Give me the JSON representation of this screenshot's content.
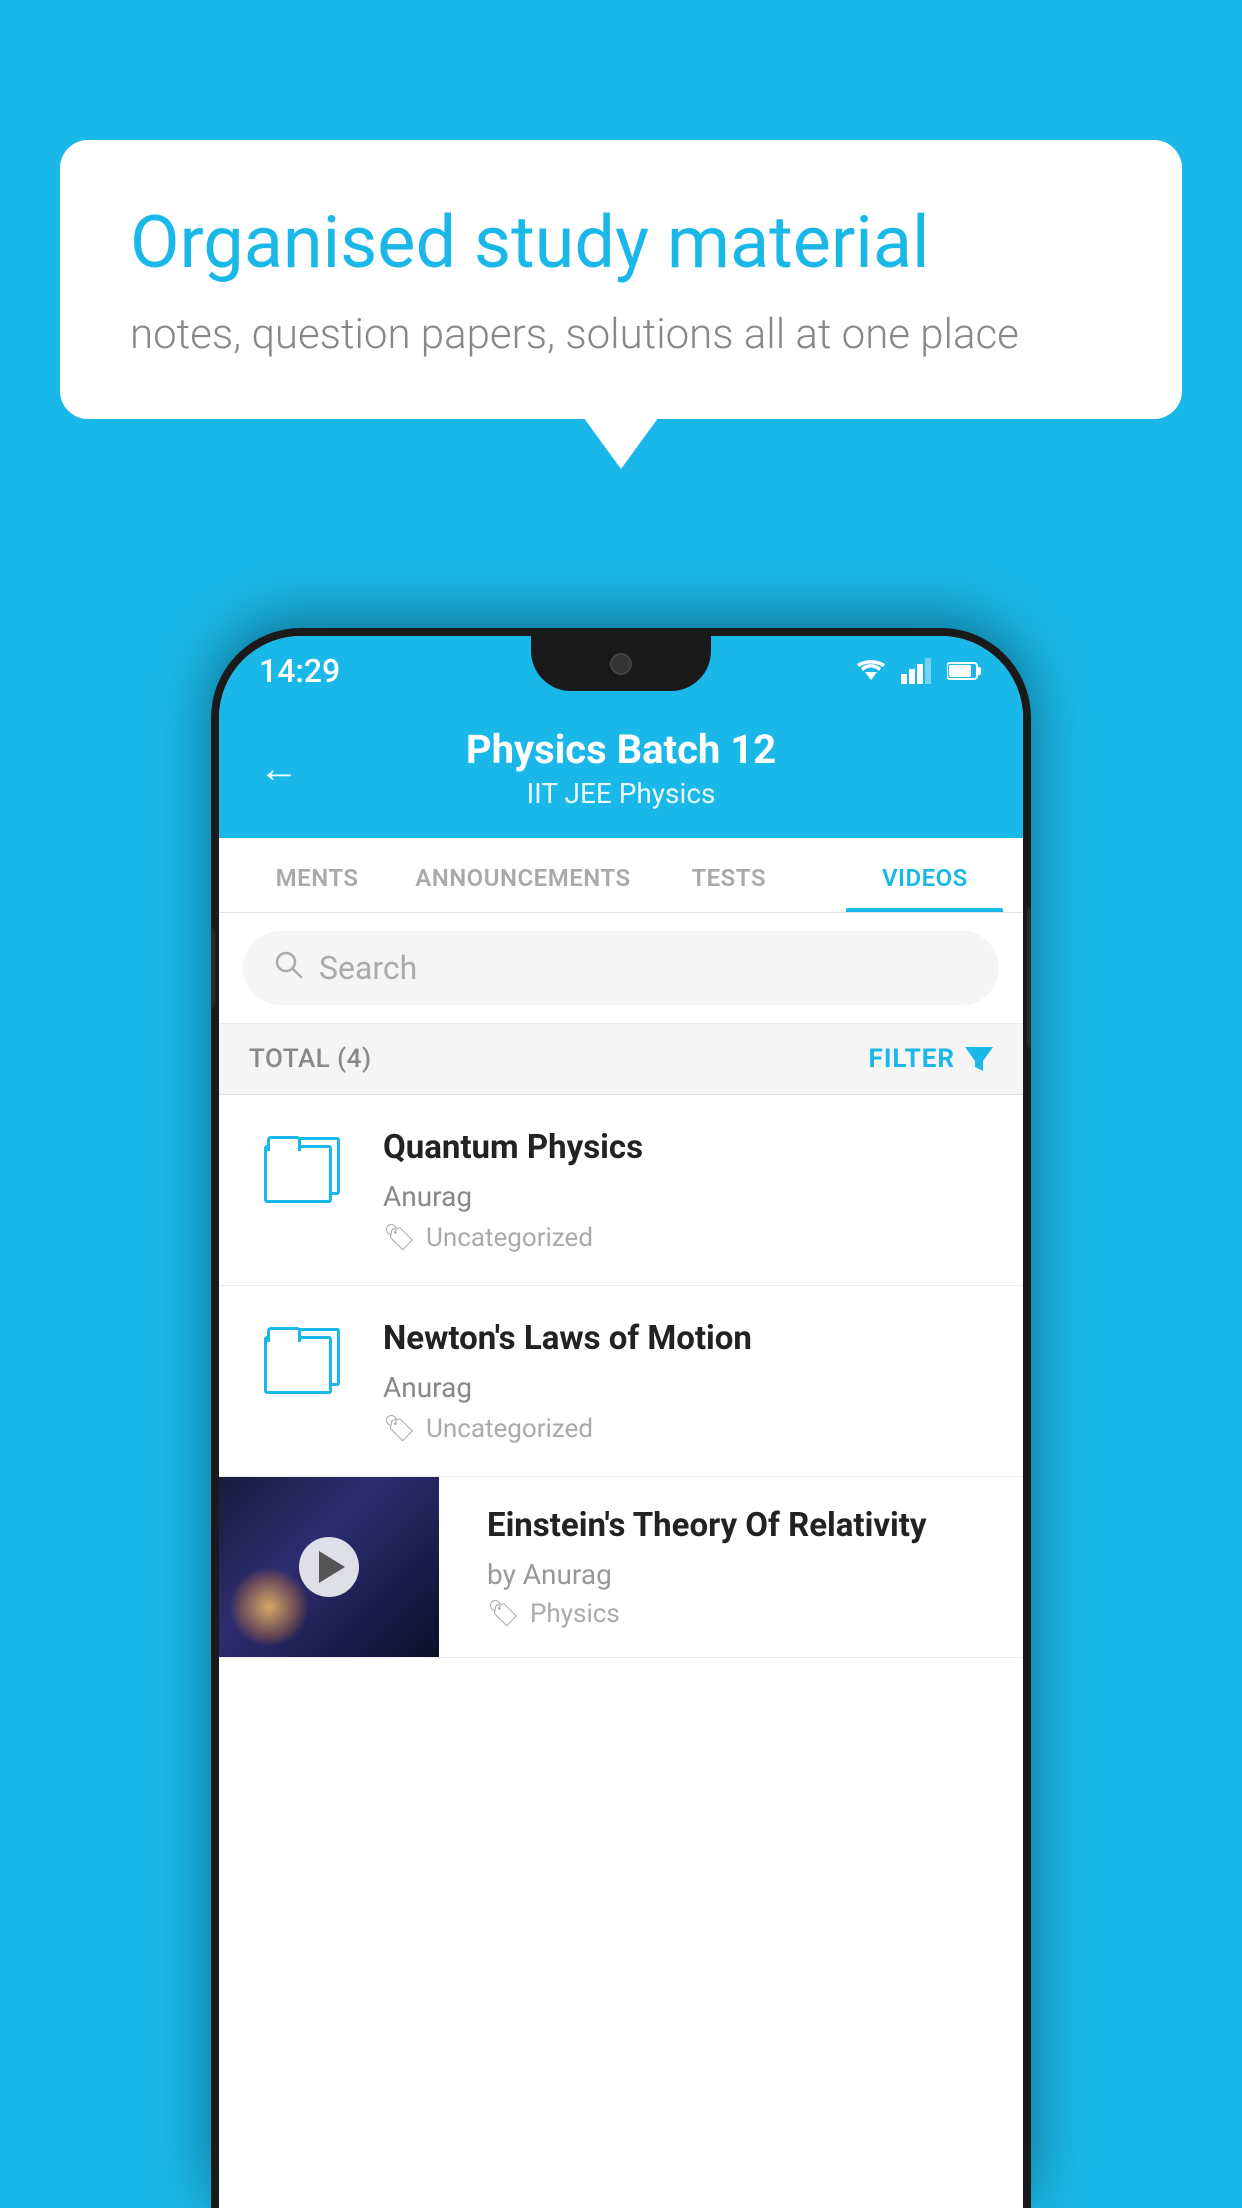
{
  "background": {
    "color": "#1ab8e8"
  },
  "bubble": {
    "title": "Organised study material",
    "subtitle": "notes, question papers, solutions all at one place"
  },
  "status_bar": {
    "time": "14:29",
    "wifi_icon": "wifi",
    "signal_icon": "signal",
    "battery_icon": "battery"
  },
  "header": {
    "back_label": "←",
    "title": "Physics Batch 12",
    "tags": "IIT JEE   Physics"
  },
  "tabs": [
    {
      "label": "MENTS",
      "active": false
    },
    {
      "label": "ANNOUNCEMENTS",
      "active": false
    },
    {
      "label": "TESTS",
      "active": false
    },
    {
      "label": "VIDEOS",
      "active": true
    }
  ],
  "search": {
    "placeholder": "Search"
  },
  "filter_bar": {
    "total_label": "TOTAL (4)",
    "filter_label": "FILTER"
  },
  "videos": [
    {
      "id": 1,
      "title": "Quantum Physics",
      "author": "Anurag",
      "tag": "Uncategorized",
      "has_thumbnail": false
    },
    {
      "id": 2,
      "title": "Newton's Laws of Motion",
      "author": "Anurag",
      "tag": "Uncategorized",
      "has_thumbnail": false
    },
    {
      "id": 3,
      "title": "Einstein's Theory Of Relativity",
      "author": "by Anurag",
      "tag": "Physics",
      "has_thumbnail": true
    }
  ]
}
